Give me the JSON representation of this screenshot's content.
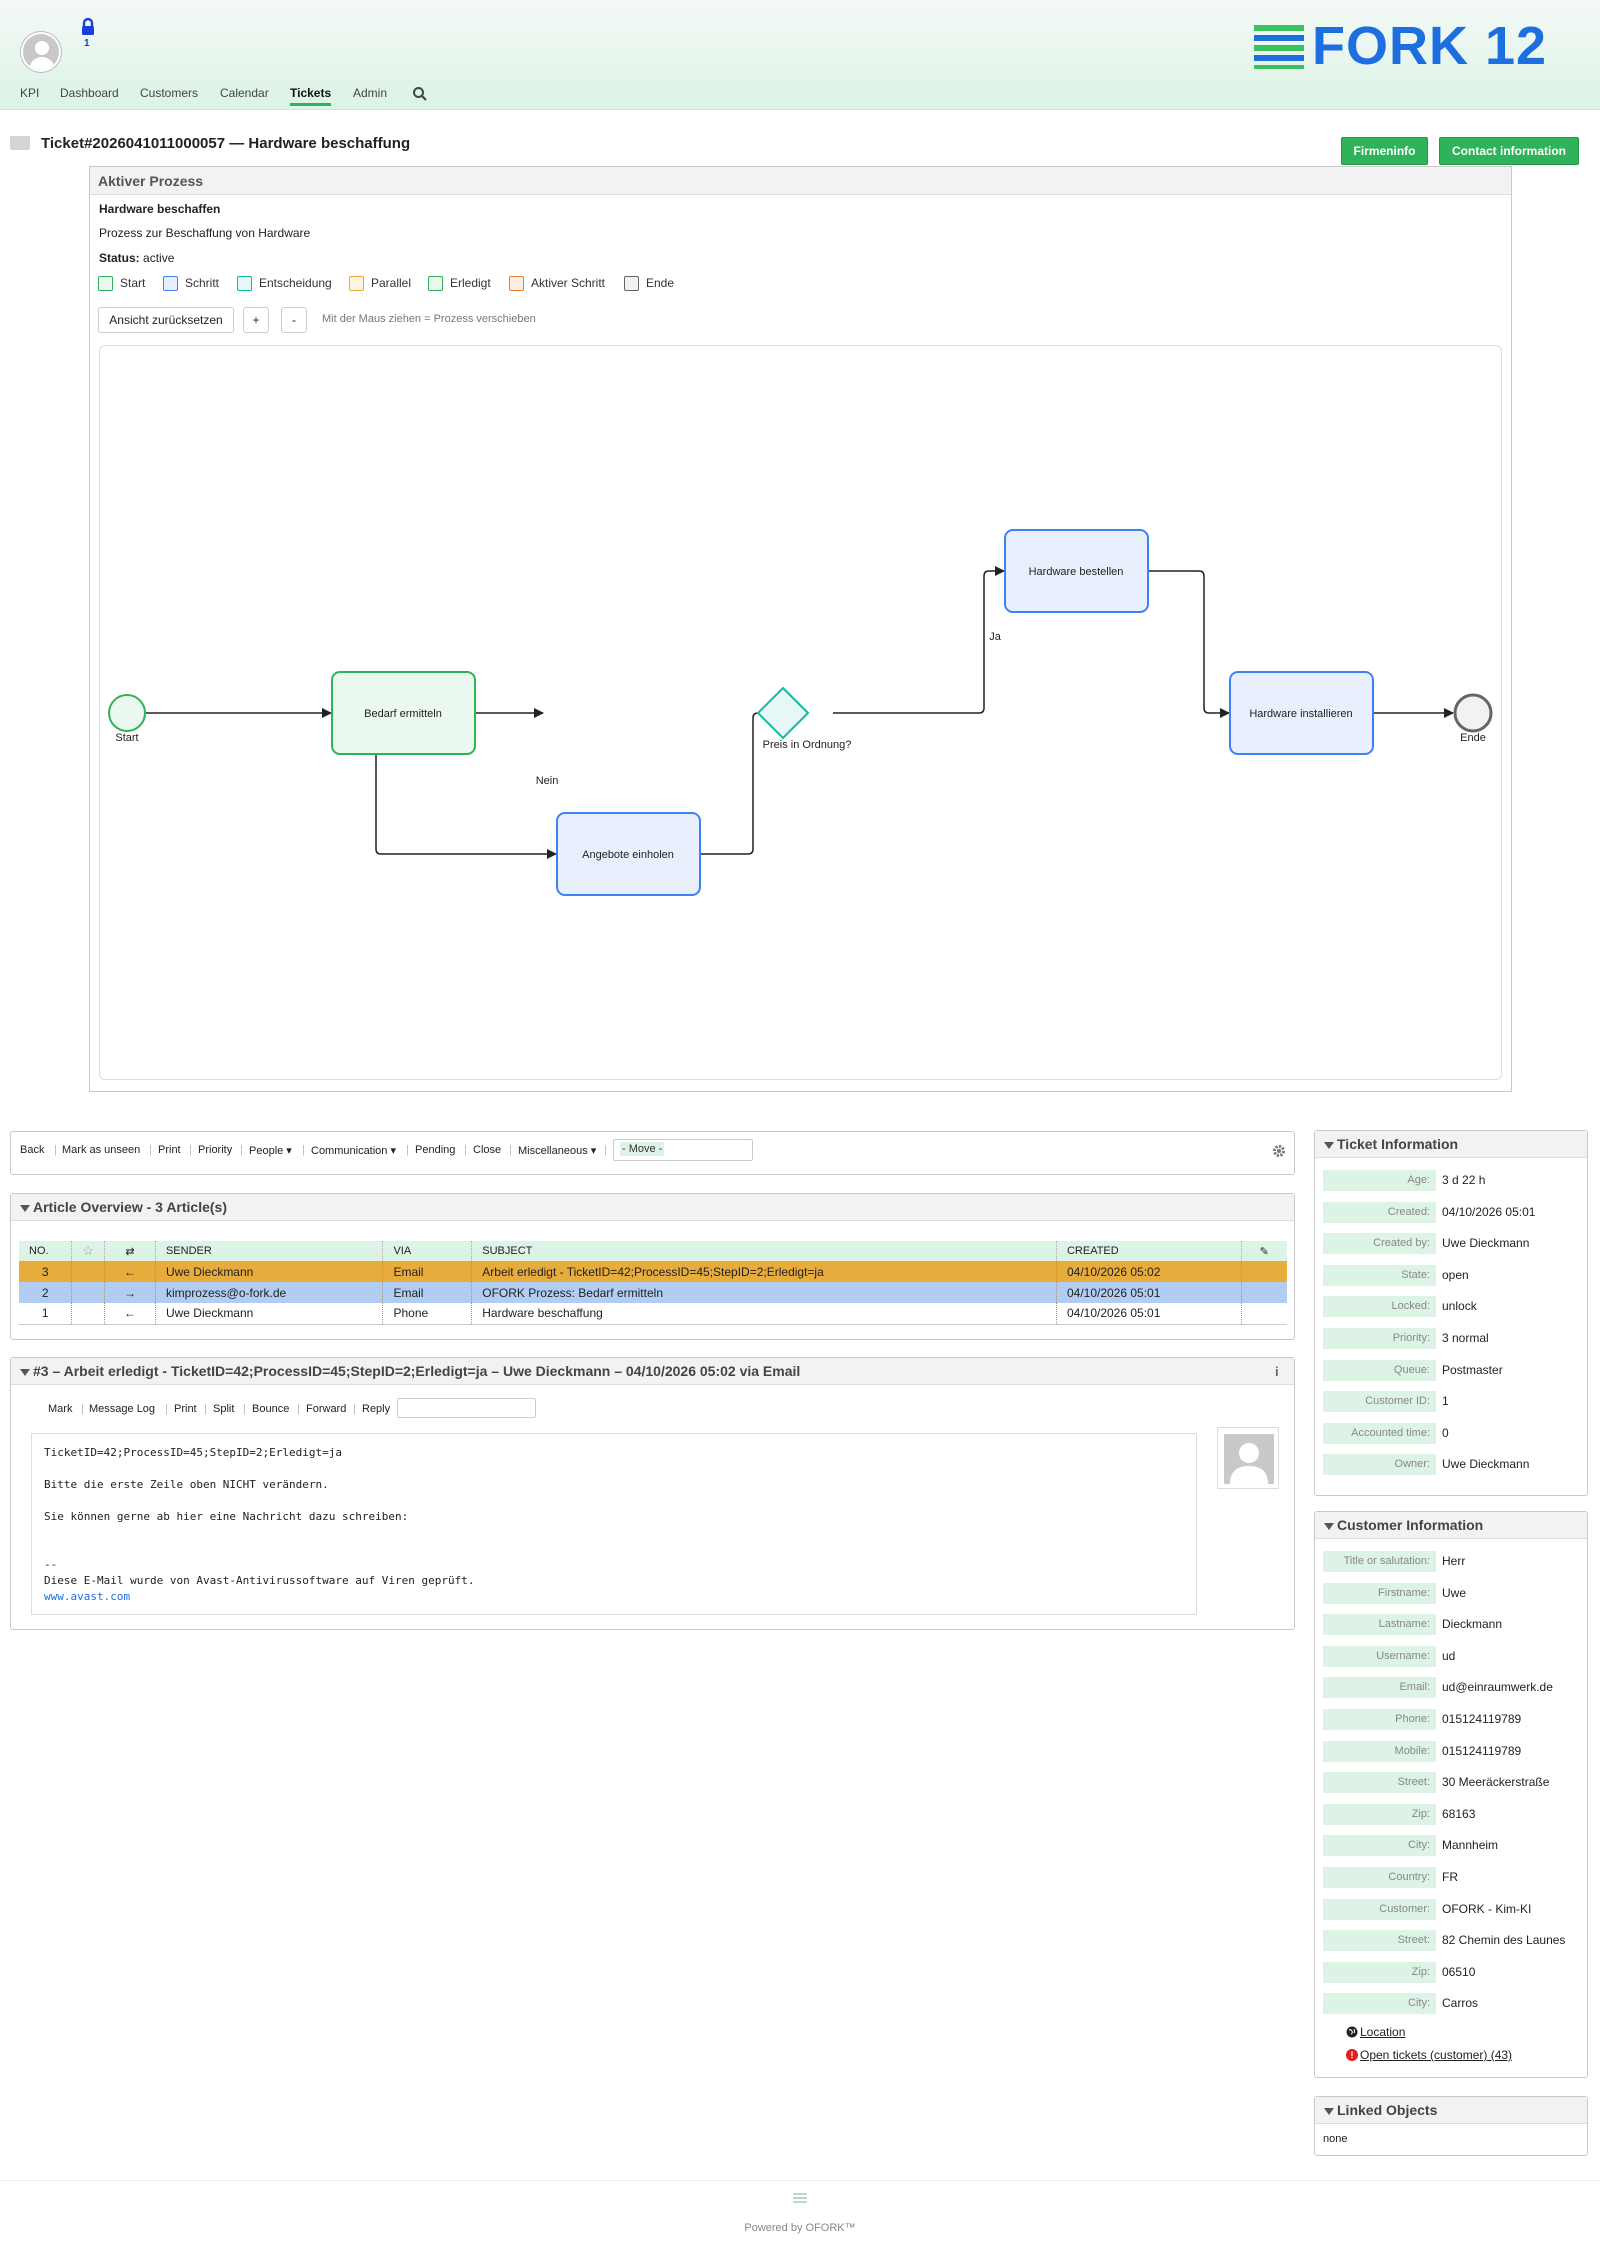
{
  "header": {
    "lock_count": "1",
    "logo_text": "FORK 12",
    "nav": [
      "KPI",
      "Dashboard",
      "Customers",
      "Calendar",
      "Tickets",
      "Admin"
    ],
    "active_nav": "Tickets"
  },
  "ticket": {
    "title": "Ticket#2026041011000057 — Hardware beschaffung",
    "buttons": {
      "firmeninfo": "Firmeninfo",
      "contact": "Contact information"
    }
  },
  "process": {
    "header": "Aktiver Prozess",
    "name": "Hardware beschaffen",
    "description": "Prozess zur Beschaffung von Hardware",
    "status_label": "Status:",
    "status_value": "active",
    "legend": [
      {
        "label": "Start",
        "color": "#2fb35a",
        "fill": "#eaf8ef"
      },
      {
        "label": "Schritt",
        "color": "#3b82f6",
        "fill": "#e8f0fd"
      },
      {
        "label": "Entscheidung",
        "color": "#14b8a6",
        "fill": "#e6f7f5"
      },
      {
        "label": "Parallel",
        "color": "#f0a830",
        "fill": "#fdf4e3"
      },
      {
        "label": "Erledigt",
        "color": "#2fb35a",
        "fill": "#eaf8ef"
      },
      {
        "label": "Aktiver Schritt",
        "color": "#f07830",
        "fill": "#fdeee3"
      },
      {
        "label": "Ende",
        "color": "#666666",
        "fill": "#f2f2f2"
      }
    ],
    "controls": {
      "reset": "Ansicht zurücksetzen",
      "zoom_in": "+",
      "zoom_out": "-",
      "hint": "Mit der Maus ziehen = Prozess verschieben"
    },
    "nodes": {
      "start": "Start",
      "bedarf": "Bedarf ermitteln",
      "angebote": "Angebote einholen",
      "decision": "Preis in Ordnung?",
      "bestellen": "Hardware bestellen",
      "installieren": "Hardware installieren",
      "ende": "Ende"
    },
    "edges": {
      "yes": "Ja",
      "no": "Nein"
    }
  },
  "toolbar": {
    "items": [
      "Back",
      "Mark as unseen",
      "Print",
      "Priority",
      "People ▾",
      "Communication ▾",
      "Pending",
      "Close",
      "Miscellaneous ▾"
    ],
    "move_placeholder": "- Move -"
  },
  "articles": {
    "header": "Article Overview - 3 Article(s)",
    "columns": [
      "NO.",
      "",
      "⇄",
      "SENDER",
      "VIA",
      "SUBJECT",
      "CREATED",
      ""
    ],
    "rows": [
      {
        "no": "3",
        "dir": "←",
        "sender": "Uwe Dieckmann",
        "via": "Email",
        "subject": "Arbeit erledigt - TicketID=42;ProcessID=45;StepID=2;Erledigt=ja",
        "created": "04/10/2026 05:02"
      },
      {
        "no": "2",
        "dir": "→",
        "sender": "kimprozess@o-fork.de",
        "via": "Email",
        "subject": "OFORK Prozess: Bedarf ermitteln",
        "created": "04/10/2026 05:01"
      },
      {
        "no": "1",
        "dir": "←",
        "sender": "Uwe Dieckmann",
        "via": "Phone",
        "subject": "Hardware beschaffung",
        "created": "04/10/2026 05:01"
      }
    ]
  },
  "article": {
    "header": "#3 – Arbeit erledigt - TicketID=42;ProcessID=45;StepID=2;Erledigt=ja – Uwe Dieckmann – 04/10/2026 05:02 via Email",
    "actions": [
      "Mark",
      "Message Log",
      "Print",
      "Split",
      "Bounce",
      "Forward",
      "Reply"
    ],
    "body_lines": [
      "TicketID=42;ProcessID=45;StepID=2;Erledigt=ja",
      "",
      "Bitte die erste Zeile oben NICHT verändern.",
      "",
      "Sie können gerne ab hier eine Nachricht dazu schreiben:",
      "",
      "",
      "--",
      "Diese E-Mail wurde von Avast-Antivirussoftware auf Viren geprüft."
    ],
    "link": "www.avast.com"
  },
  "ticket_info": {
    "header": "Ticket Information",
    "fields": [
      {
        "label": "Age:",
        "value": "3 d 22 h"
      },
      {
        "label": "Created:",
        "value": "04/10/2026 05:01"
      },
      {
        "label": "Created by:",
        "value": "Uwe Dieckmann"
      },
      {
        "label": "State:",
        "value": "open"
      },
      {
        "label": "Locked:",
        "value": "unlock"
      },
      {
        "label": "Priority:",
        "value": "3 normal"
      },
      {
        "label": "Queue:",
        "value": "Postmaster"
      },
      {
        "label": "Customer ID:",
        "value": "1"
      },
      {
        "label": "Accounted time:",
        "value": "0"
      },
      {
        "label": "Owner:",
        "value": "Uwe Dieckmann"
      }
    ]
  },
  "customer_info": {
    "header": "Customer Information",
    "fields": [
      {
        "label": "Title or salutation:",
        "value": "Herr"
      },
      {
        "label": "Firstname:",
        "value": "Uwe"
      },
      {
        "label": "Lastname:",
        "value": "Dieckmann"
      },
      {
        "label": "Username:",
        "value": "ud"
      },
      {
        "label": "Email:",
        "value": "ud@einraumwerk.de"
      },
      {
        "label": "Phone:",
        "value": "015124119789"
      },
      {
        "label": "Mobile:",
        "value": "015124119789"
      },
      {
        "label": "Street:",
        "value": "30 Meeräckerstraße"
      },
      {
        "label": "Zip:",
        "value": "68163"
      },
      {
        "label": "City:",
        "value": "Mannheim"
      },
      {
        "label": "Country:",
        "value": "FR"
      },
      {
        "label": "Customer:",
        "value": "OFORK - Kim-KI"
      },
      {
        "label": "Street:",
        "value": "82 Chemin des Launes"
      },
      {
        "label": "Zip:",
        "value": "06510"
      },
      {
        "label": "City:",
        "value": "Carros"
      }
    ],
    "location_link": "Location",
    "open_tickets_link": "Open tickets (customer) (43)"
  },
  "linked_objects": {
    "header": "Linked Objects",
    "value": "none"
  },
  "footer": {
    "text": "Powered by OFORK™"
  }
}
